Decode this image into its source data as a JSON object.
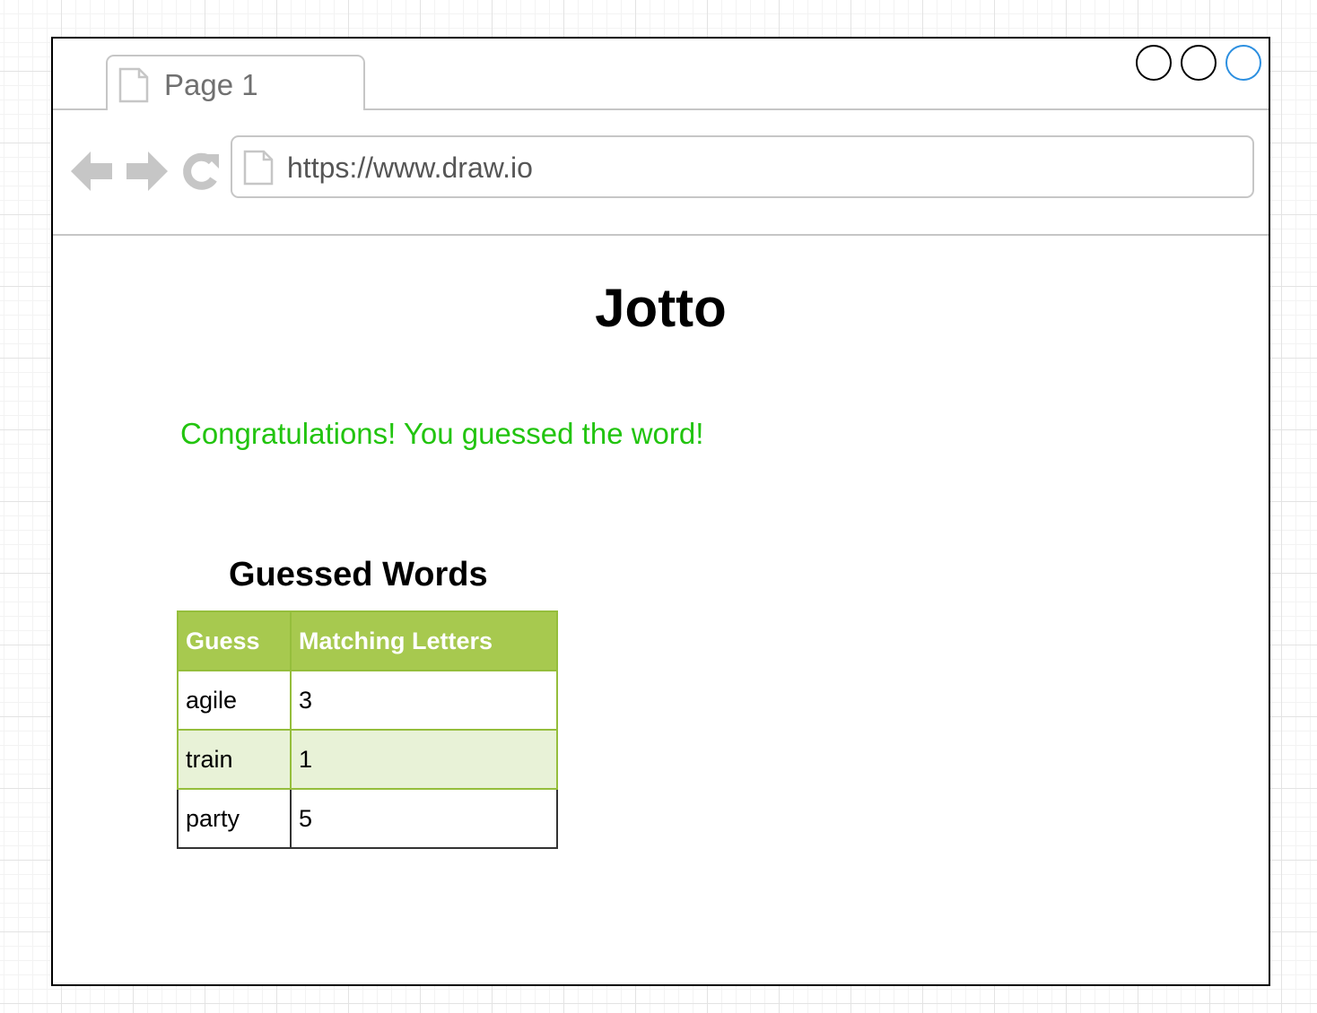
{
  "browser": {
    "tab_title": "Page 1",
    "url": "https://www.draw.io",
    "icons": {
      "back": "arrow-left-icon",
      "forward": "arrow-right-icon",
      "reload": "reload-icon",
      "page": "page-icon"
    },
    "window_controls": [
      "minimize",
      "maximize",
      "close"
    ],
    "colors": {
      "chrome_gray": "#c6c6c6",
      "close_accent": "#2c8fe0"
    }
  },
  "page": {
    "title": "Jotto",
    "success_message": "Congratulations! You guessed the word!",
    "success_color": "#22c40f"
  },
  "guessed_words": {
    "heading": "Guessed Words",
    "columns": [
      "Guess",
      "Matching Letters"
    ],
    "header_color": "#a7c94f",
    "rows": [
      {
        "guess": "agile",
        "matching": "3"
      },
      {
        "guess": "train",
        "matching": "1"
      },
      {
        "guess": "party",
        "matching": "5"
      }
    ]
  }
}
